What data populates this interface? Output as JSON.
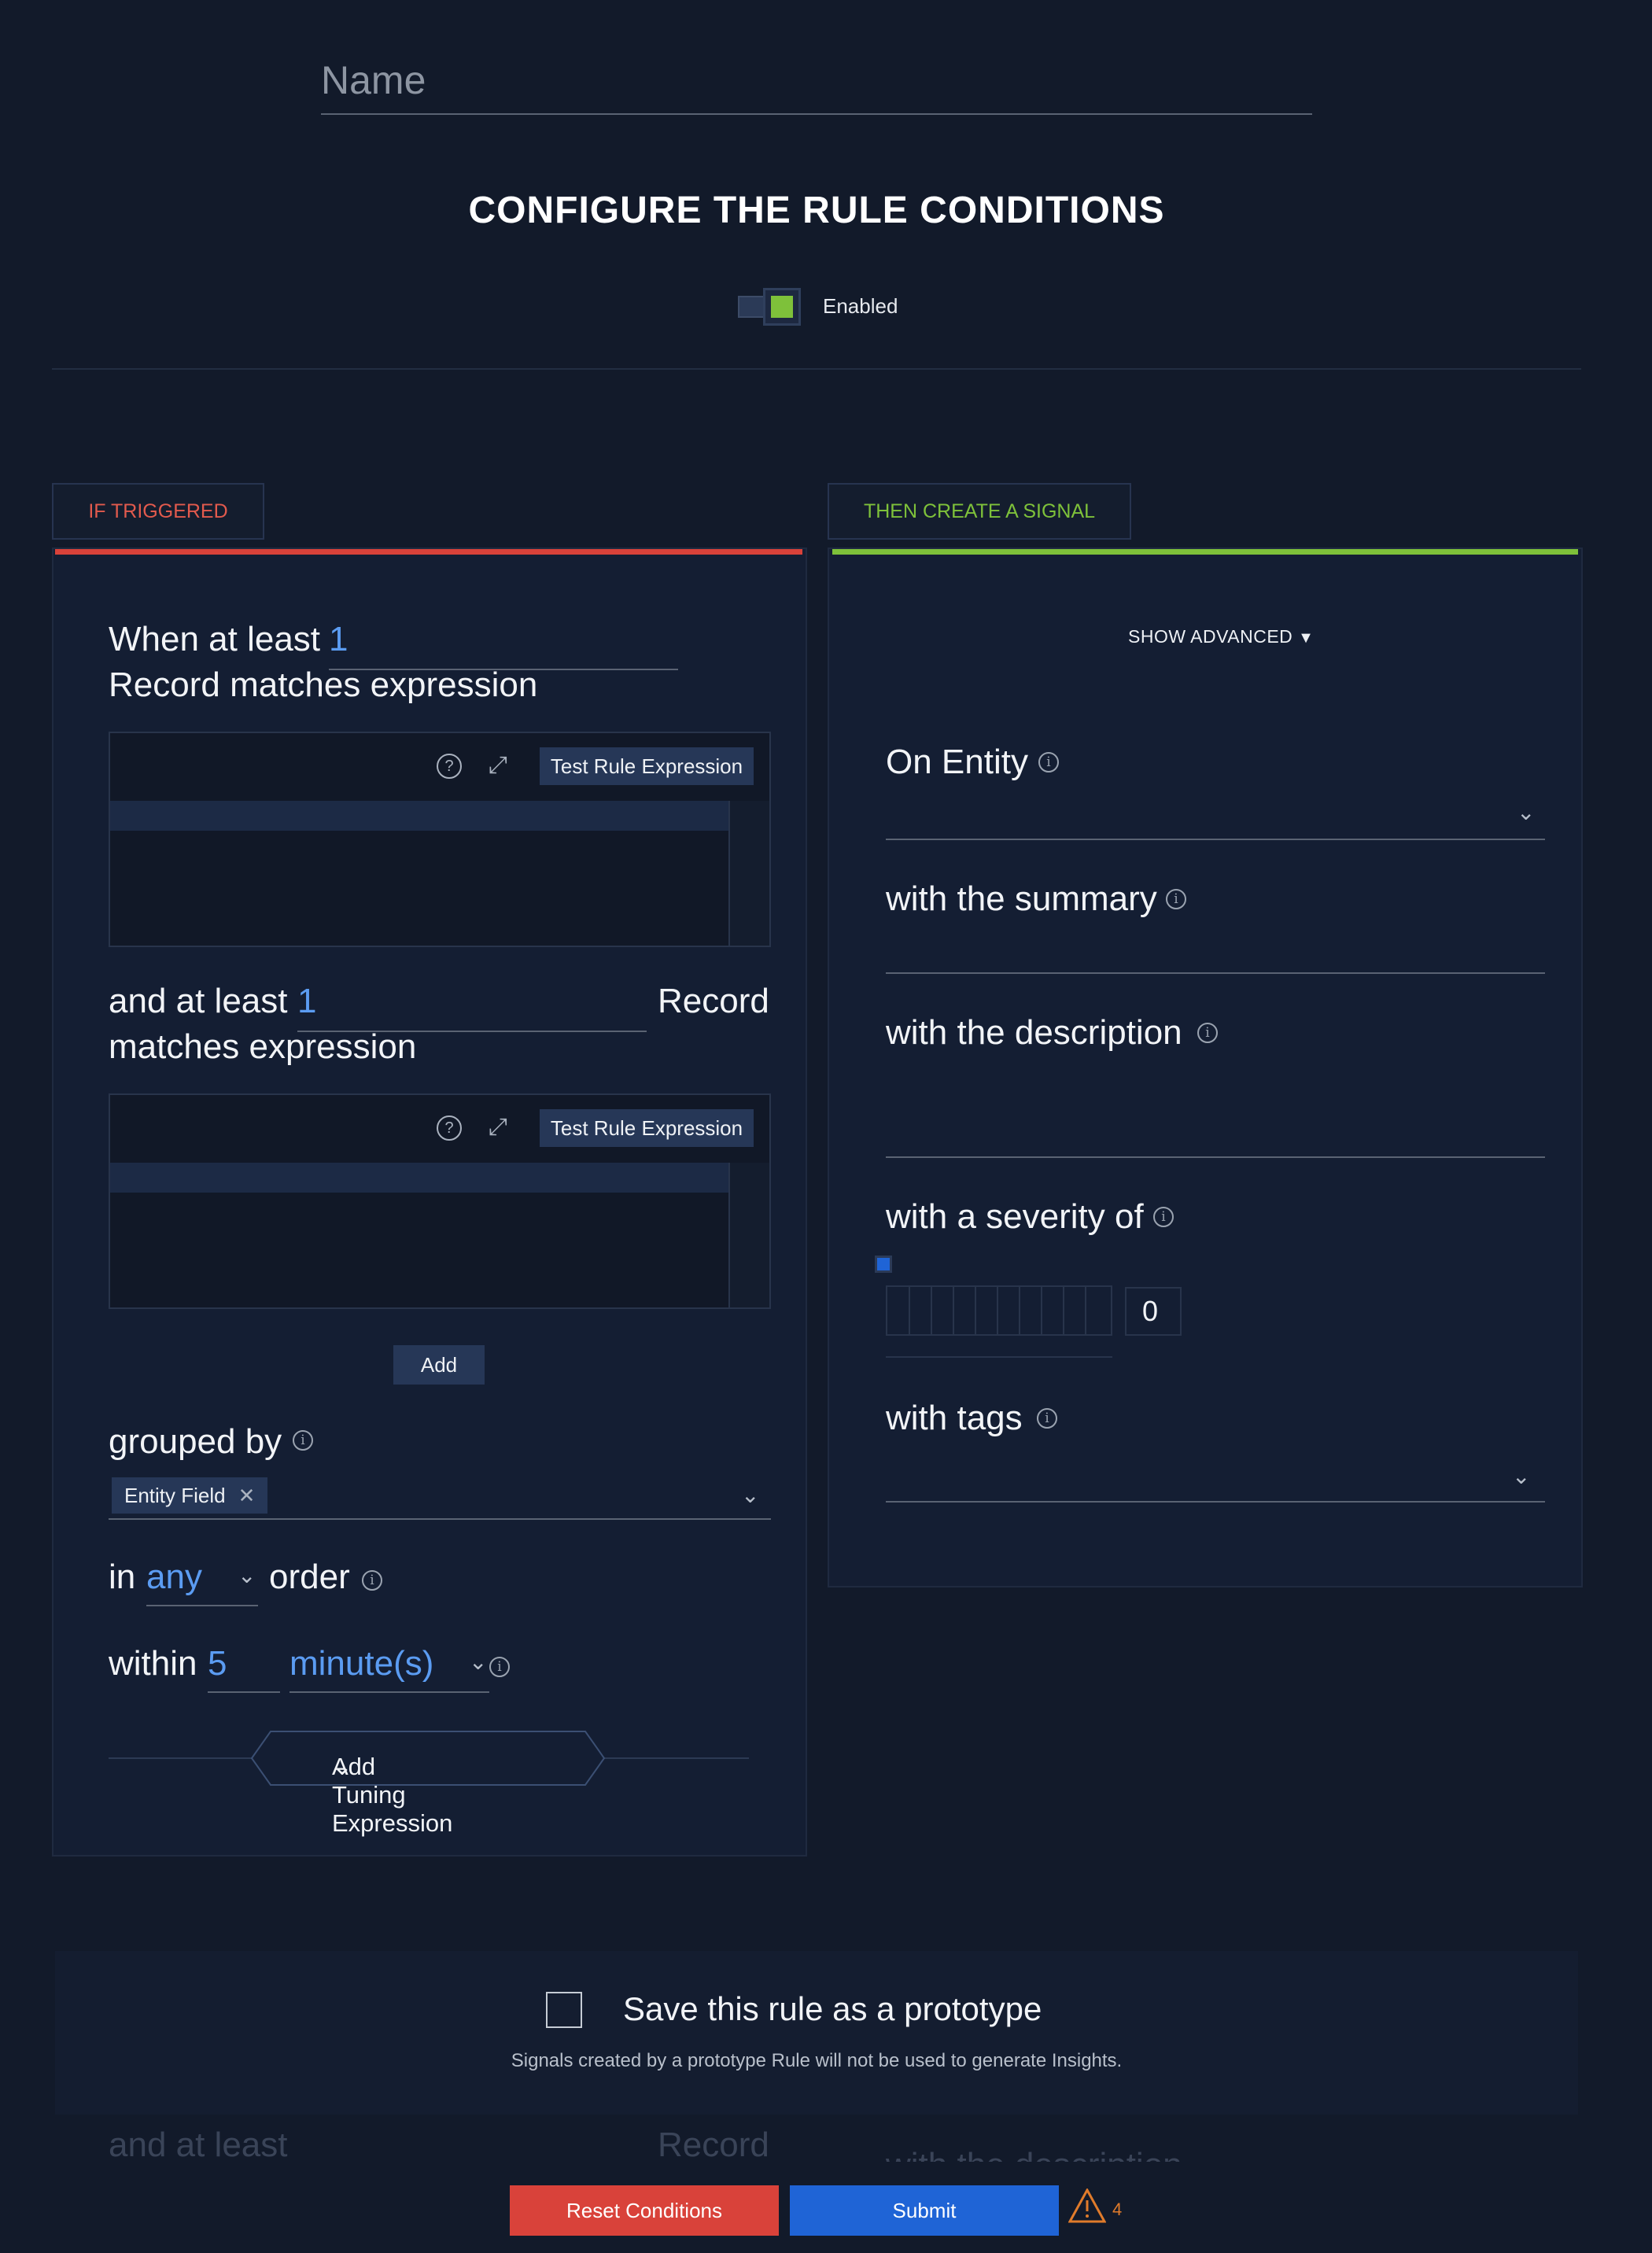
{
  "header": {
    "name_placeholder": "Name",
    "title": "CONFIGURE THE RULE CONDITIONS",
    "toggle_label": "Enabled",
    "toggle_on": true
  },
  "tabs": {
    "if_triggered": "IF TRIGGERED",
    "then_create": "THEN CREATE A SIGNAL"
  },
  "left": {
    "when_at_least": "When at least",
    "count1": "1",
    "record_matches": "Record matches expression",
    "test_button": "Test Rule Expression",
    "help_icon": "?",
    "and_at_least": "and at least",
    "count2": "1",
    "record": "Record",
    "matches_expression": "matches expression",
    "add_button": "Add",
    "grouped_by": "grouped by",
    "group_chip": "Entity Field",
    "in": "in",
    "order_value": "any",
    "order": "order",
    "within": "within",
    "within_value": "5",
    "within_unit": "minute(s)",
    "tuning_button": "Add Tuning Expression"
  },
  "right": {
    "show_advanced": "SHOW ADVANCED",
    "on_entity": "On Entity",
    "with_summary": "with the summary",
    "with_description": "with the description",
    "with_severity": "with a severity of",
    "severity_value": "0",
    "with_tags": "with tags"
  },
  "prototype": {
    "label": "Save this rule as a prototype",
    "note": "Signals created by a prototype Rule will not be used to generate Insights.",
    "checked": false
  },
  "footer": {
    "reset": "Reset Conditions",
    "submit": "Submit",
    "warning_count": "4"
  },
  "ghost": {
    "and_at_least": "and at least",
    "record": "Record",
    "with_description": "with the description"
  },
  "colors": {
    "accent_red": "#d9423a",
    "accent_green": "#7ec13a",
    "accent_blue": "#1f64d6",
    "value_blue": "#5b9cf2",
    "background": "#121a2a"
  }
}
